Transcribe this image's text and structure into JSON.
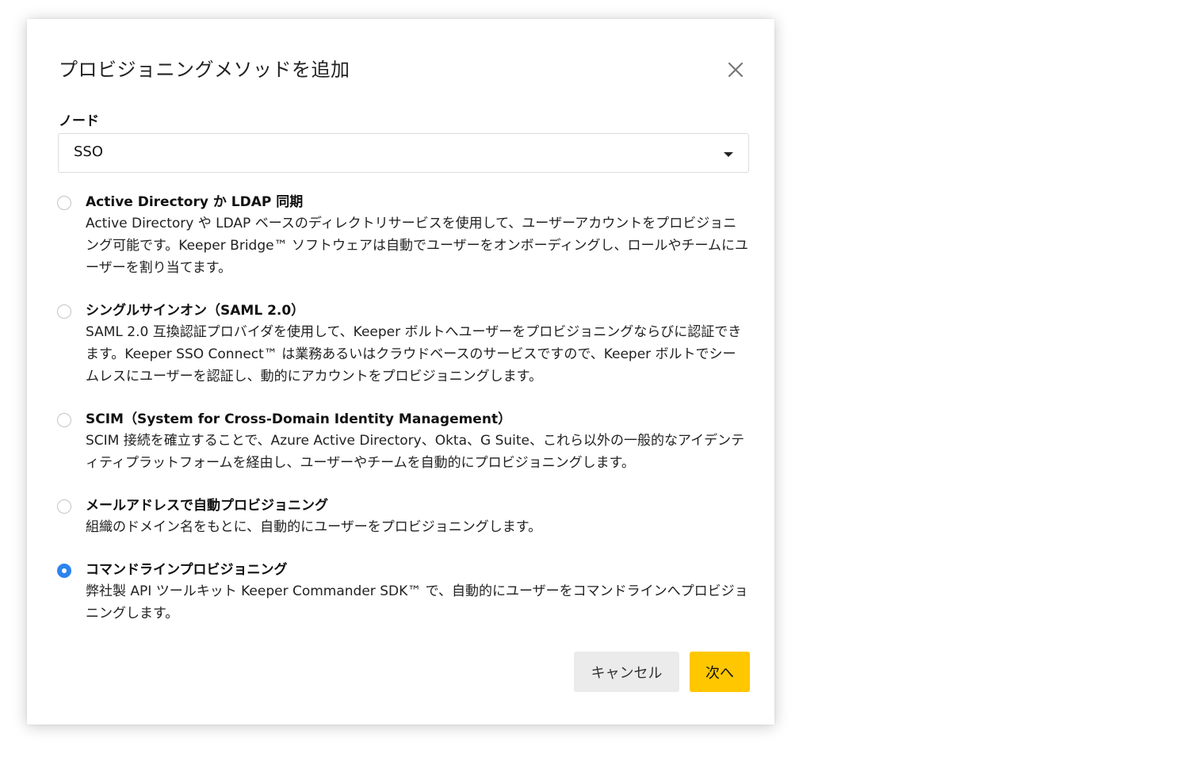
{
  "dialog": {
    "title": "プロビジョニングメソッドを追加",
    "close_icon": "close-icon"
  },
  "node": {
    "label": "ノード",
    "selected": "SSO"
  },
  "options": [
    {
      "title": "Active Directory か LDAP 同期",
      "description": "Active Directory や LDAP ベースのディレクトリサービスを使用して、ユーザーアカウントをプロビジョニング可能です。Keeper Bridge™ ソフトウェアは自動でユーザーをオンボーディングし、ロールやチームにユーザーを割り当てます。",
      "checked": false
    },
    {
      "title": "シングルサインオン（SAML 2.0）",
      "description": "SAML 2.0 互換認証プロバイダを使用して、Keeper ボルトへユーザーをプロビジョニングならびに認証できます。Keeper SSO Connect™ は業務あるいはクラウドベースのサービスですので、Keeper ボルトでシームレスにユーザーを認証し、動的にアカウントをプロビジョニングします。",
      "checked": false
    },
    {
      "title": "SCIM（System for Cross-Domain Identity Management）",
      "description": "SCIM 接続を確立することで、Azure Active Directory、Okta、G Suite、これら以外の一般的なアイデンティティプラットフォームを経由し、ユーザーやチームを自動的にプロビジョニングします。",
      "checked": false
    },
    {
      "title": "メールアドレスで自動プロビジョニング",
      "description": "組織のドメイン名をもとに、自動的にユーザーをプロビジョニングします。",
      "checked": false
    },
    {
      "title": "コマンドラインプロビジョニング",
      "description": "弊社製 API ツールキット Keeper Commander SDK™ で、自動的にユーザーをコマンドラインへプロビジョニングします。",
      "checked": true
    }
  ],
  "buttons": {
    "cancel": "キャンセル",
    "next": "次へ"
  },
  "colors": {
    "accent_radio": "#2c84ee",
    "primary_button": "#ffc700",
    "secondary_button": "#ebebeb"
  }
}
